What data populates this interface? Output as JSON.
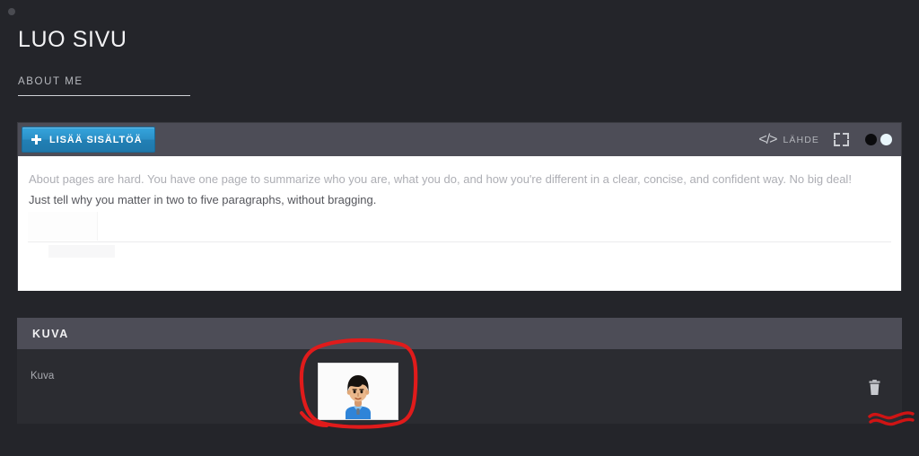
{
  "window": {
    "background_color": "#24252a",
    "status_dot": "status-dot"
  },
  "header": {
    "title": "LUO SIVU"
  },
  "tabs": [
    {
      "label": "ABOUT ME",
      "active": true
    }
  ],
  "editor": {
    "toolbar": {
      "add_content_label": "LISÄÄ SISÄLTÖÄ",
      "add_icon": "plus-icon",
      "source_icon": "code-brackets-icon",
      "source_label": "LÄHDE",
      "fullscreen_icon": "fullscreen-icon",
      "toggle_dark": "dark-mode-dot",
      "toggle_light": "light-mode-dot",
      "accent_color": "#2b8fc6",
      "toolbar_color": "#4d4d57"
    },
    "content": {
      "line1": "About pages are hard. You have one page to summarize who you are, what you do, and how you're different in a clear, concise, and confident way. No big deal!",
      "line2": "Just tell why you matter in two to five paragraphs, without bragging."
    }
  },
  "image_panel": {
    "section_title": "KUVA",
    "field_label": "Kuva",
    "thumbnail_alt": "avatar-thumbnail",
    "delete_icon": "trash-icon"
  },
  "annotations": {
    "color": "#e01b1b",
    "circle": "red-circle-around-thumbnail",
    "squiggle": "red-squiggle-under-trash-icon"
  }
}
